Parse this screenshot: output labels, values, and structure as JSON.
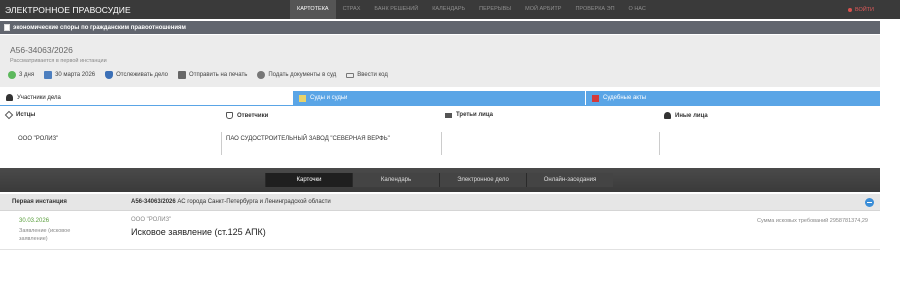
{
  "topbar": {
    "brand": "ЭЛЕКТРОННОЕ ПРАВОСУДИЕ",
    "nav": [
      "КАРТОТЕКА",
      "СТРАХ",
      "БАНК РЕШЕНИЙ",
      "КАЛЕНДАРЬ",
      "ПЕРЕРЫВЫ",
      "МОЙ АРБИТР",
      "ПРОВЕРКА ЭП",
      "О НАС"
    ],
    "login": "ВОЙТИ"
  },
  "category": {
    "label": "экономические споры по гражданским правоотношениям"
  },
  "case": {
    "number": "А56-34063/2026",
    "status": "Рассматривается в первой инстанции",
    "actions": [
      {
        "icon": "clock-icon",
        "label": "3 дня"
      },
      {
        "icon": "calendar-icon",
        "label": "30 марта 2026"
      },
      {
        "icon": "shield-icon",
        "label": "Отслеживать дело"
      },
      {
        "icon": "print-icon",
        "label": "Отправить на печать"
      },
      {
        "icon": "gear-icon",
        "label": "Подать документы в суд"
      },
      {
        "icon": "code-icon",
        "label": "Ввести код"
      }
    ]
  },
  "tabs": {
    "participants": "Участники дела",
    "courts": "Суды и судьи",
    "acts": "Судебные акты"
  },
  "participants": {
    "plaintiffs_label": "Истцы",
    "defendants_label": "Ответчики",
    "third_label": "Третьи лица",
    "others_label": "Иные лица",
    "plaintiff": "ООО \"РОЛИЗ\"",
    "defendant": "ПАО СУДОСТРОИТЕЛЬНЫЙ ЗАВОД \"СЕВЕРНАЯ ВЕРФЬ\""
  },
  "toggles": [
    "Карточки",
    "Календарь",
    "Электронное дело",
    "Онлайн-заседания"
  ],
  "instance": {
    "label": "Первая инстанция",
    "case_number": "А56-34063/2026",
    "court": "АС города Санкт-Петербурга и Ленинградской области"
  },
  "event": {
    "date": "30.03.2026",
    "type": "Заявление (исковое заявление)",
    "party": "ООО \"РОЛИЗ\"",
    "title": "Исковое заявление (ст.125 АПК)",
    "sum": "Сумма исковых требований 2958781374,29"
  }
}
